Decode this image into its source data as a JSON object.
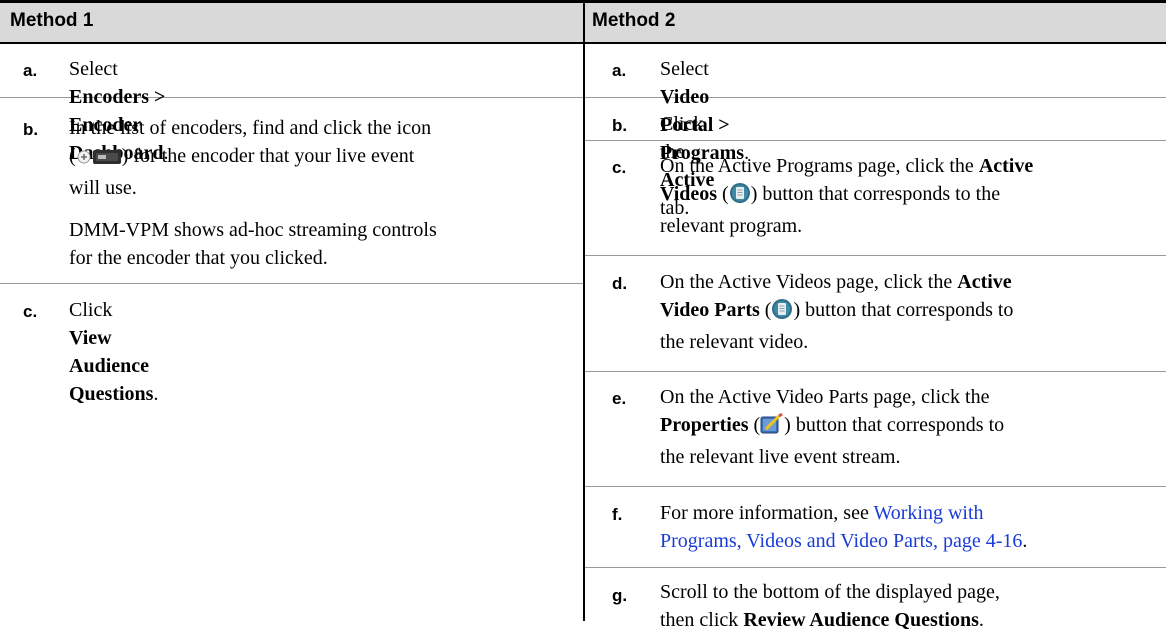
{
  "header": {
    "col1": "Method 1",
    "col2": "Method 2"
  },
  "method1": {
    "a": {
      "letter": "a.",
      "pre": "Select ",
      "bold": "Encoders > Encoder Dashboard",
      "post": "."
    },
    "b": {
      "letter": "b.",
      "line1": "In the list of encoders, find and click the icon",
      "line2_open": "(",
      "line2_close": ") for the encoder that your live event",
      "line3": "will use.",
      "note1": "DMM-VPM shows ad-hoc streaming controls",
      "note2": "for the encoder that you clicked."
    },
    "c": {
      "letter": "c.",
      "pre": "Click ",
      "bold": "View Audience Questions",
      "post": "."
    }
  },
  "method2": {
    "a": {
      "letter": "a.",
      "pre": "Select ",
      "bold": "Video Portal > Programs",
      "post": "."
    },
    "b": {
      "letter": "b.",
      "pre": "Click the ",
      "bold": "Active",
      "post": " tab."
    },
    "c": {
      "letter": "c.",
      "line1_pre": "On the Active Programs page, click the ",
      "line1_bold": "Active",
      "line2_bold": "Videos",
      "line2_open": " (",
      "line2_close": ") button that corresponds to the",
      "line3": "relevant program."
    },
    "d": {
      "letter": "d.",
      "line1_pre": "On the Active Videos page, click the ",
      "line1_bold": "Active",
      "line2_bold": "Video Parts",
      "line2_open": " (",
      "line2_close": ") button that corresponds to",
      "line3": "the relevant video."
    },
    "e": {
      "letter": "e.",
      "line1": "On the Active Video Parts page, click the",
      "line2_bold": "Properties",
      "line2_open": " (",
      "line2_close": ") button that corresponds to",
      "line3": "the relevant live event stream."
    },
    "f": {
      "letter": "f.",
      "pre": "For more information, see ",
      "link1": "Working with",
      "link2": "Programs, Videos and Video Parts, page 4-16",
      "post": "."
    },
    "g": {
      "letter": "g.",
      "line1": "Scroll to the bottom of the displayed page,",
      "line2_pre": "then click ",
      "line2_bold": "Review Audience Questions",
      "line2_post": "."
    }
  },
  "colors": {
    "header_bg": "#d9d9d9",
    "link": "#1a3cd6",
    "rule": "#000000"
  },
  "icons": [
    "encoder-icon",
    "active-list-icon",
    "properties-icon"
  ]
}
